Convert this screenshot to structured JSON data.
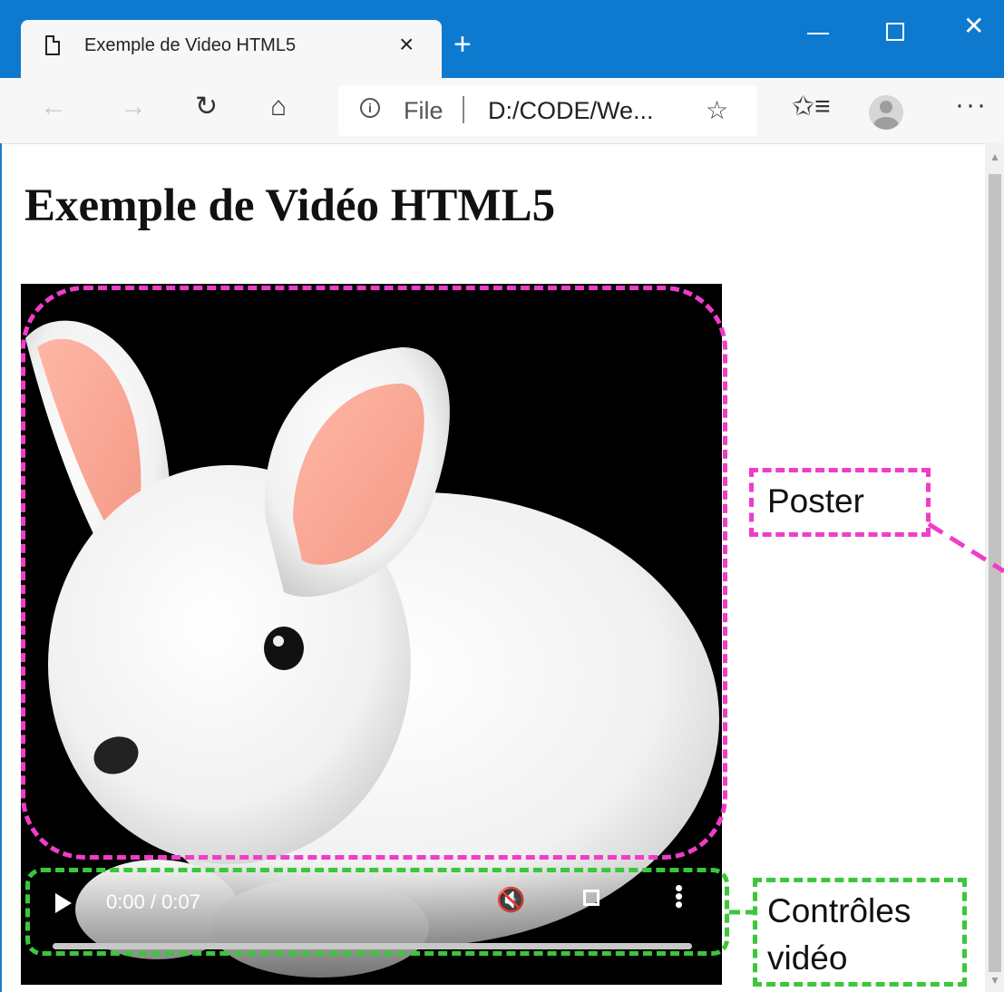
{
  "browser": {
    "tab_title": "Exemple de Video HTML5",
    "tab_close": "×",
    "new_tab": "+",
    "window_min": "",
    "window_close": "✕",
    "nav_back": "←",
    "nav_forward": "→",
    "nav_refresh": "↻",
    "nav_home": "⌂",
    "address_info": "i",
    "address_scheme": "File",
    "address_url": "D:/CODE/We...",
    "favorite_star": "☆",
    "favorites_icon": "✩≡",
    "more": "···"
  },
  "page": {
    "heading": "Exemple de Vidéo HTML5"
  },
  "video": {
    "time_display": "0:00 / 0:07",
    "progress_fraction": 0,
    "mute_icon": "🔇",
    "more_icon": "•••"
  },
  "annotations": {
    "poster_label": "Poster",
    "controls_label_line1": "Contrôles",
    "controls_label_line2": "vidéo",
    "poster_color": "#ef3dc8",
    "controls_color": "#3cc63c"
  }
}
